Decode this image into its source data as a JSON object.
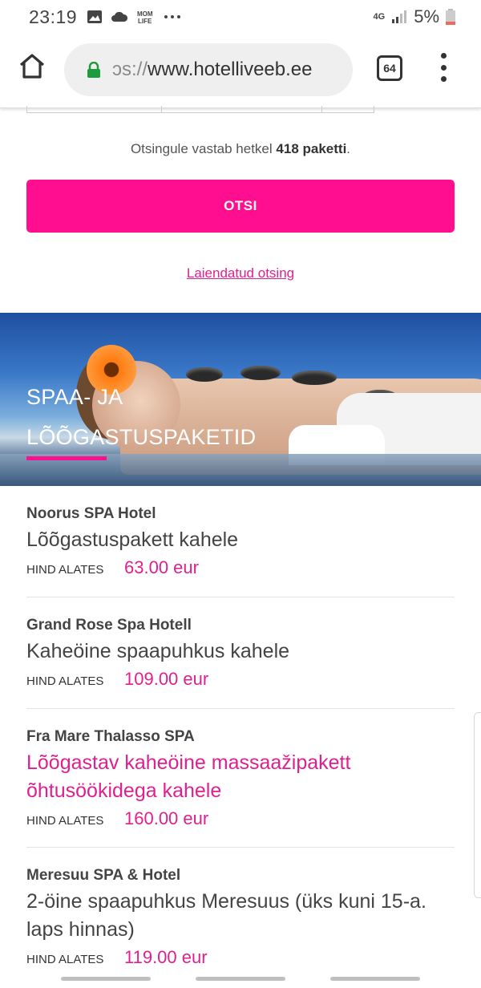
{
  "status_bar": {
    "time": "23:19",
    "network": "4G",
    "battery": "5%",
    "icons": [
      "image-icon",
      "cloud-icon",
      "momlife-icon",
      "more-icon"
    ]
  },
  "browser": {
    "url_scheme": "ɔs://",
    "url_host": "www.hotelliveeb.ee",
    "tab_count": "64"
  },
  "search": {
    "result_prefix": "Otsingule vastab hetkel",
    "result_count": "418 paketti",
    "result_suffix": ".",
    "button_label": "OTSI",
    "advanced_link": "Laiendatud otsing"
  },
  "banner": {
    "title_line1": "SPAA- JA",
    "title_line2": "LÕÕGASTUSPAKETID"
  },
  "packages": [
    {
      "hotel": "Noorus SPA Hotel",
      "title": "Lõõgastuspakett kahele",
      "price_label": "HIND ALATES",
      "price": "63.00 eur"
    },
    {
      "hotel": "Grand Rose Spa Hotell",
      "title": "Kaheöine spaapuhkus kahele",
      "price_label": "HIND ALATES",
      "price": "109.00 eur"
    },
    {
      "hotel": "Fra Mare Thalasso SPA",
      "title": "Lõõgastav kaheöine massaažipakett õhtusöökidega kahele",
      "price_label": "HIND ALATES",
      "price": "160.00 eur"
    },
    {
      "hotel": "Meresuu SPA & Hotel",
      "title": "2-öine spaapuhkus Meresuus (üks kuni 15-a. laps hinnas)",
      "price_label": "HIND ALATES",
      "price": "119.00 eur"
    }
  ],
  "colors": {
    "accent": "#ff0f8f",
    "link": "#e0208e"
  }
}
